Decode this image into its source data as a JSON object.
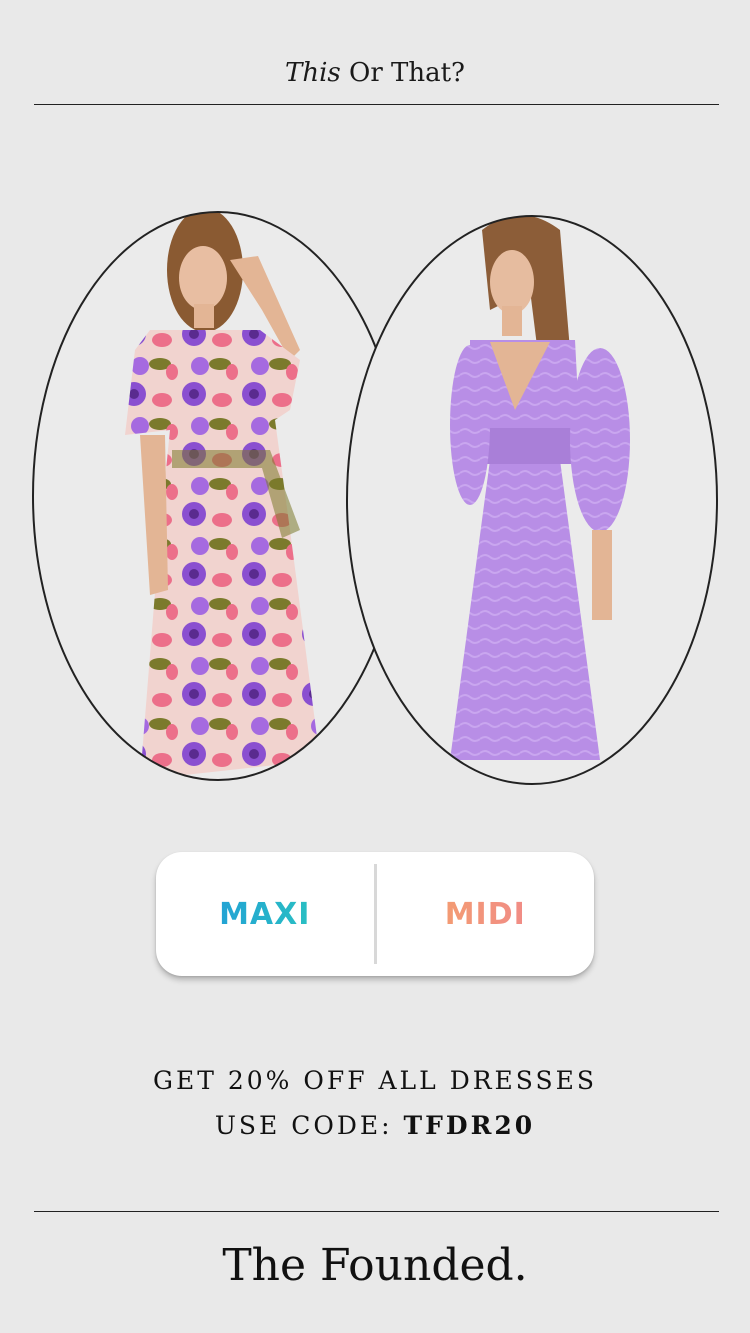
{
  "header": {
    "title_italic": "This",
    "title_rest": " Or That?"
  },
  "photos": {
    "left_alt": "floral print wrap dress",
    "right_alt": "lilac puff-sleeve dress"
  },
  "poll": {
    "option_a": "MAXI",
    "option_b": "MIDI"
  },
  "promo": {
    "line1": "GET 20% OFF ALL DRESSES",
    "line2_prefix": "USE CODE: ",
    "code": "TFDR20"
  },
  "footer": {
    "brand": "The Founded."
  },
  "colors": {
    "background": "#e9e9e9",
    "maxi_gradient": [
      "#1e8fe0",
      "#2ed3b7"
    ],
    "midi_gradient": [
      "#f6a863",
      "#ee7f96"
    ],
    "floral_purple": "#8a4fd0",
    "floral_pink": "#ec6f8a",
    "floral_olive": "#7b7a2c",
    "lilac": "#b88ee6"
  }
}
